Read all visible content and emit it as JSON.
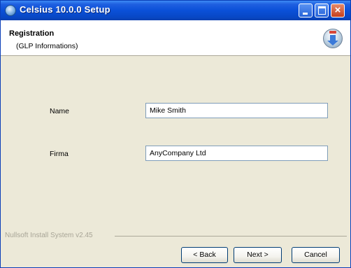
{
  "window": {
    "title": "Celsius 10.0.0 Setup"
  },
  "header": {
    "title": "Registration",
    "subtitle": "(GLP Informations)",
    "icon": "installer-disc-icon"
  },
  "form": {
    "name_label": "Name",
    "name_value": "Mike Smith",
    "firma_label": "Firma",
    "firma_value": "AnyCompany Ltd"
  },
  "footer": {
    "branding": "Nullsoft Install System v2.45"
  },
  "buttons": {
    "back": "< Back",
    "next": "Next >",
    "cancel": "Cancel"
  }
}
